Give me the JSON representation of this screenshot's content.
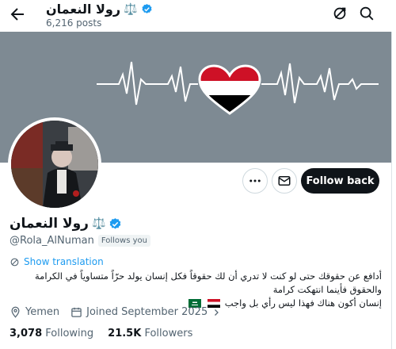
{
  "header": {
    "title": "رولا النعمان",
    "scales_icon": "⚖️",
    "posts_count": "6,216 posts"
  },
  "profile": {
    "name": "رولا النعمان",
    "scales_icon": "⚖️",
    "handle": "@Rola_AlNuman",
    "follows_you": "Follows you",
    "follow_back_label": "Follow back",
    "show_translation": "Show translation",
    "bio_line1": "أدافع عن حقوقك حتى لو كنت لا تدري أن لك حقوقاً فكل إنسان يولد حرّاً متساوياً في الكرامة والحقوق فأينما انتهكت كرامة",
    "bio_line2": "إنسان أكون هناك فهذا ليس رأي بل واجب",
    "location": "Yemen",
    "joined": "Joined September 2025",
    "following_count": "3,078",
    "following_label": "Following",
    "followers_count": "21.5K",
    "followers_label": "Followers"
  },
  "colors": {
    "banner": "#7e8a93",
    "verified": "#1d9bf0",
    "link": "#1d9bf0",
    "follow_button": "#0f1419"
  },
  "icons": [
    "back-arrow-icon",
    "verified-badge-icon",
    "refresh-icon",
    "search-icon",
    "more-icon",
    "message-icon",
    "location-icon",
    "calendar-icon",
    "translate-icon",
    "yemen-flag-icon",
    "saudi-flag-icon",
    "heart-flag-icon"
  ]
}
